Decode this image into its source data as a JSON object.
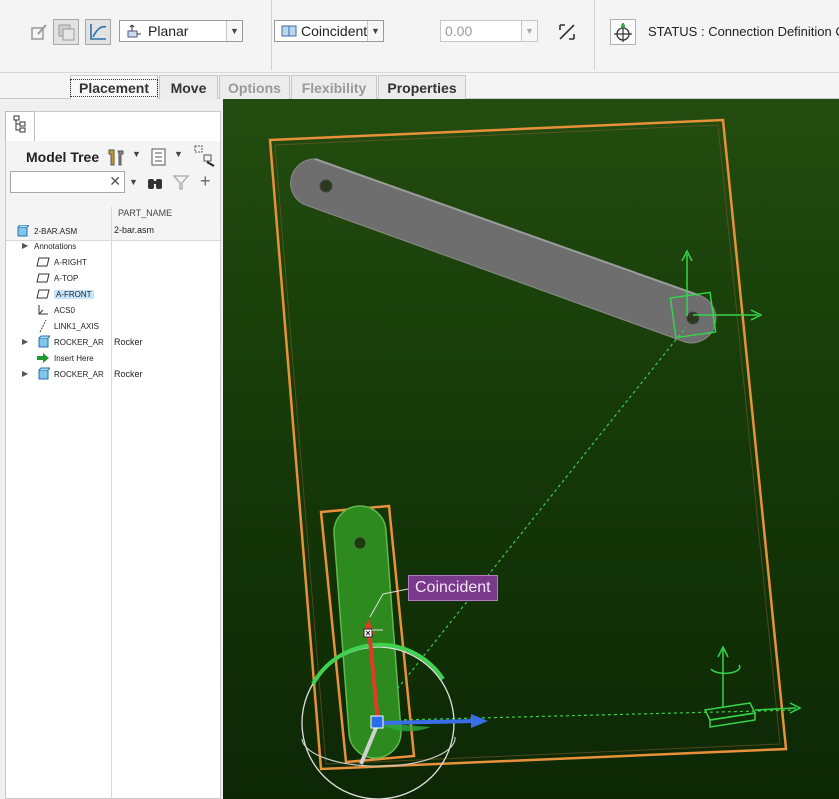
{
  "toolbar": {
    "connection_type": "Planar",
    "constraint_type": "Coincident",
    "offset_value": "0.00",
    "status": "STATUS : Connection Definition C"
  },
  "tabs": [
    {
      "label": "Placement",
      "state": "active"
    },
    {
      "label": "Move",
      "state": "enabled"
    },
    {
      "label": "Options",
      "state": "disabled"
    },
    {
      "label": "Flexibility",
      "state": "disabled"
    },
    {
      "label": "Properties",
      "state": "enabled"
    }
  ],
  "model_tree": {
    "title": "Model Tree",
    "search_value": "",
    "column_header": "PART_NAME",
    "items": [
      {
        "label": "2-BAR.ASM",
        "part_name": "2-bar.asm",
        "icon": "assembly-icon"
      },
      {
        "label": "Annotations",
        "part_name": "",
        "icon": "annotations-icon"
      },
      {
        "label": "A-RIGHT",
        "part_name": "",
        "icon": "datum-plane-icon"
      },
      {
        "label": "A-TOP",
        "part_name": "",
        "icon": "datum-plane-icon"
      },
      {
        "label": "A-FRONT",
        "part_name": "",
        "icon": "datum-plane-icon"
      },
      {
        "label": "ACS0",
        "part_name": "",
        "icon": "coordinate-system-icon"
      },
      {
        "label": "LINK1_AXIS",
        "part_name": "",
        "icon": "axis-icon"
      },
      {
        "label": "ROCKER_AR",
        "part_name": "Rocker",
        "icon": "part-icon"
      },
      {
        "label": "Insert Here",
        "part_name": "",
        "icon": "insert-here-icon"
      },
      {
        "label": "ROCKER_AR",
        "part_name": "Rocker",
        "icon": "part-icon"
      }
    ]
  },
  "viewport": {
    "constraint_label": "Coincident"
  },
  "colors": {
    "accent_orange": "#e8913a",
    "drag_green": "#35d44a",
    "label_purple": "#7a3a8c"
  }
}
